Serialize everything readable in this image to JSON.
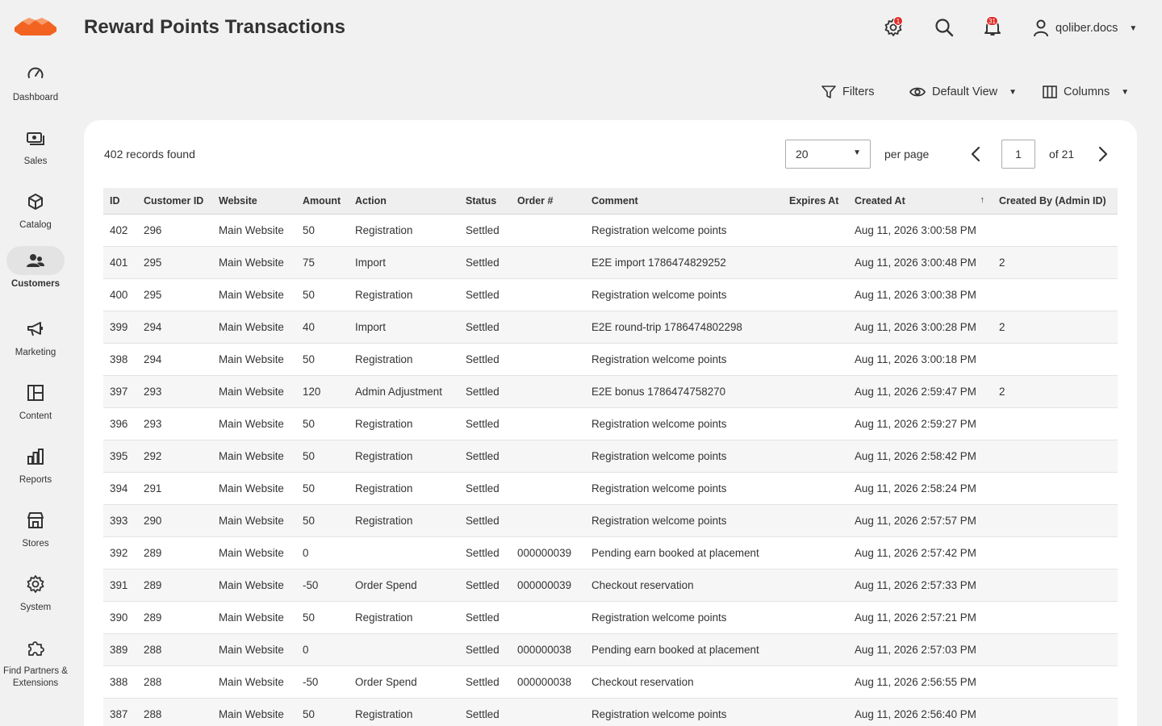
{
  "header": {
    "title": "Reward Points Transactions",
    "notif_badge_1": "1",
    "notif_badge_2": "31",
    "username": "qoliber.docs"
  },
  "sidebar": {
    "items": [
      {
        "label": "Dashboard",
        "icon": "dashboard-icon"
      },
      {
        "label": "Sales",
        "icon": "sales-icon"
      },
      {
        "label": "Catalog",
        "icon": "catalog-icon"
      },
      {
        "label": "Customers",
        "icon": "customers-icon",
        "active": true
      },
      {
        "label": "Marketing",
        "icon": "marketing-icon"
      },
      {
        "label": "Content",
        "icon": "content-icon"
      },
      {
        "label": "Reports",
        "icon": "reports-icon"
      },
      {
        "label": "Stores",
        "icon": "stores-icon"
      },
      {
        "label": "System",
        "icon": "system-icon"
      },
      {
        "label": "Find Partners & Extensions",
        "icon": "extensions-icon"
      }
    ]
  },
  "toolbar": {
    "filters_label": "Filters",
    "view_label": "Default View",
    "columns_label": "Columns"
  },
  "grid": {
    "records_found": "402 records found",
    "per_page_value": "20",
    "per_page_label": "per page",
    "current_page": "1",
    "total_pages_label": "of 21",
    "columns": [
      "ID",
      "Customer ID",
      "Website",
      "Amount",
      "Action",
      "Status",
      "Order #",
      "Comment",
      "Expires At",
      "Created At",
      "Created By (Admin ID)"
    ],
    "rows": [
      [
        "402",
        "296",
        "Main Website",
        "50",
        "Registration",
        "Settled",
        "",
        "Registration welcome points",
        "",
        "Aug 11, 2026 3:00:58 PM",
        ""
      ],
      [
        "401",
        "295",
        "Main Website",
        "75",
        "Import",
        "Settled",
        "",
        "E2E import 1786474829252",
        "",
        "Aug 11, 2026 3:00:48 PM",
        "2"
      ],
      [
        "400",
        "295",
        "Main Website",
        "50",
        "Registration",
        "Settled",
        "",
        "Registration welcome points",
        "",
        "Aug 11, 2026 3:00:38 PM",
        ""
      ],
      [
        "399",
        "294",
        "Main Website",
        "40",
        "Import",
        "Settled",
        "",
        "E2E round-trip 1786474802298",
        "",
        "Aug 11, 2026 3:00:28 PM",
        "2"
      ],
      [
        "398",
        "294",
        "Main Website",
        "50",
        "Registration",
        "Settled",
        "",
        "Registration welcome points",
        "",
        "Aug 11, 2026 3:00:18 PM",
        ""
      ],
      [
        "397",
        "293",
        "Main Website",
        "120",
        "Admin Adjustment",
        "Settled",
        "",
        "E2E bonus 1786474758270",
        "",
        "Aug 11, 2026 2:59:47 PM",
        "2"
      ],
      [
        "396",
        "293",
        "Main Website",
        "50",
        "Registration",
        "Settled",
        "",
        "Registration welcome points",
        "",
        "Aug 11, 2026 2:59:27 PM",
        ""
      ],
      [
        "395",
        "292",
        "Main Website",
        "50",
        "Registration",
        "Settled",
        "",
        "Registration welcome points",
        "",
        "Aug 11, 2026 2:58:42 PM",
        ""
      ],
      [
        "394",
        "291",
        "Main Website",
        "50",
        "Registration",
        "Settled",
        "",
        "Registration welcome points",
        "",
        "Aug 11, 2026 2:58:24 PM",
        ""
      ],
      [
        "393",
        "290",
        "Main Website",
        "50",
        "Registration",
        "Settled",
        "",
        "Registration welcome points",
        "",
        "Aug 11, 2026 2:57:57 PM",
        ""
      ],
      [
        "392",
        "289",
        "Main Website",
        "0",
        "",
        "Settled",
        "000000039",
        "Pending earn booked at placement",
        "",
        "Aug 11, 2026 2:57:42 PM",
        ""
      ],
      [
        "391",
        "289",
        "Main Website",
        "-50",
        "Order Spend",
        "Settled",
        "000000039",
        "Checkout reservation",
        "",
        "Aug 11, 2026 2:57:33 PM",
        ""
      ],
      [
        "390",
        "289",
        "Main Website",
        "50",
        "Registration",
        "Settled",
        "",
        "Registration welcome points",
        "",
        "Aug 11, 2026 2:57:21 PM",
        ""
      ],
      [
        "389",
        "288",
        "Main Website",
        "0",
        "",
        "Settled",
        "000000038",
        "Pending earn booked at placement",
        "",
        "Aug 11, 2026 2:57:03 PM",
        ""
      ],
      [
        "388",
        "288",
        "Main Website",
        "-50",
        "Order Spend",
        "Settled",
        "000000038",
        "Checkout reservation",
        "",
        "Aug 11, 2026 2:56:55 PM",
        ""
      ],
      [
        "387",
        "288",
        "Main Website",
        "50",
        "Registration",
        "Settled",
        "",
        "Registration welcome points",
        "",
        "Aug 11, 2026 2:56:40 PM",
        ""
      ]
    ],
    "sorted_column": "Created At",
    "sort_direction": "ascending-arrow"
  },
  "colors": {
    "logo_orange": "#f26322",
    "badge_red": "#e02b27",
    "background": "#f1f1f1"
  }
}
